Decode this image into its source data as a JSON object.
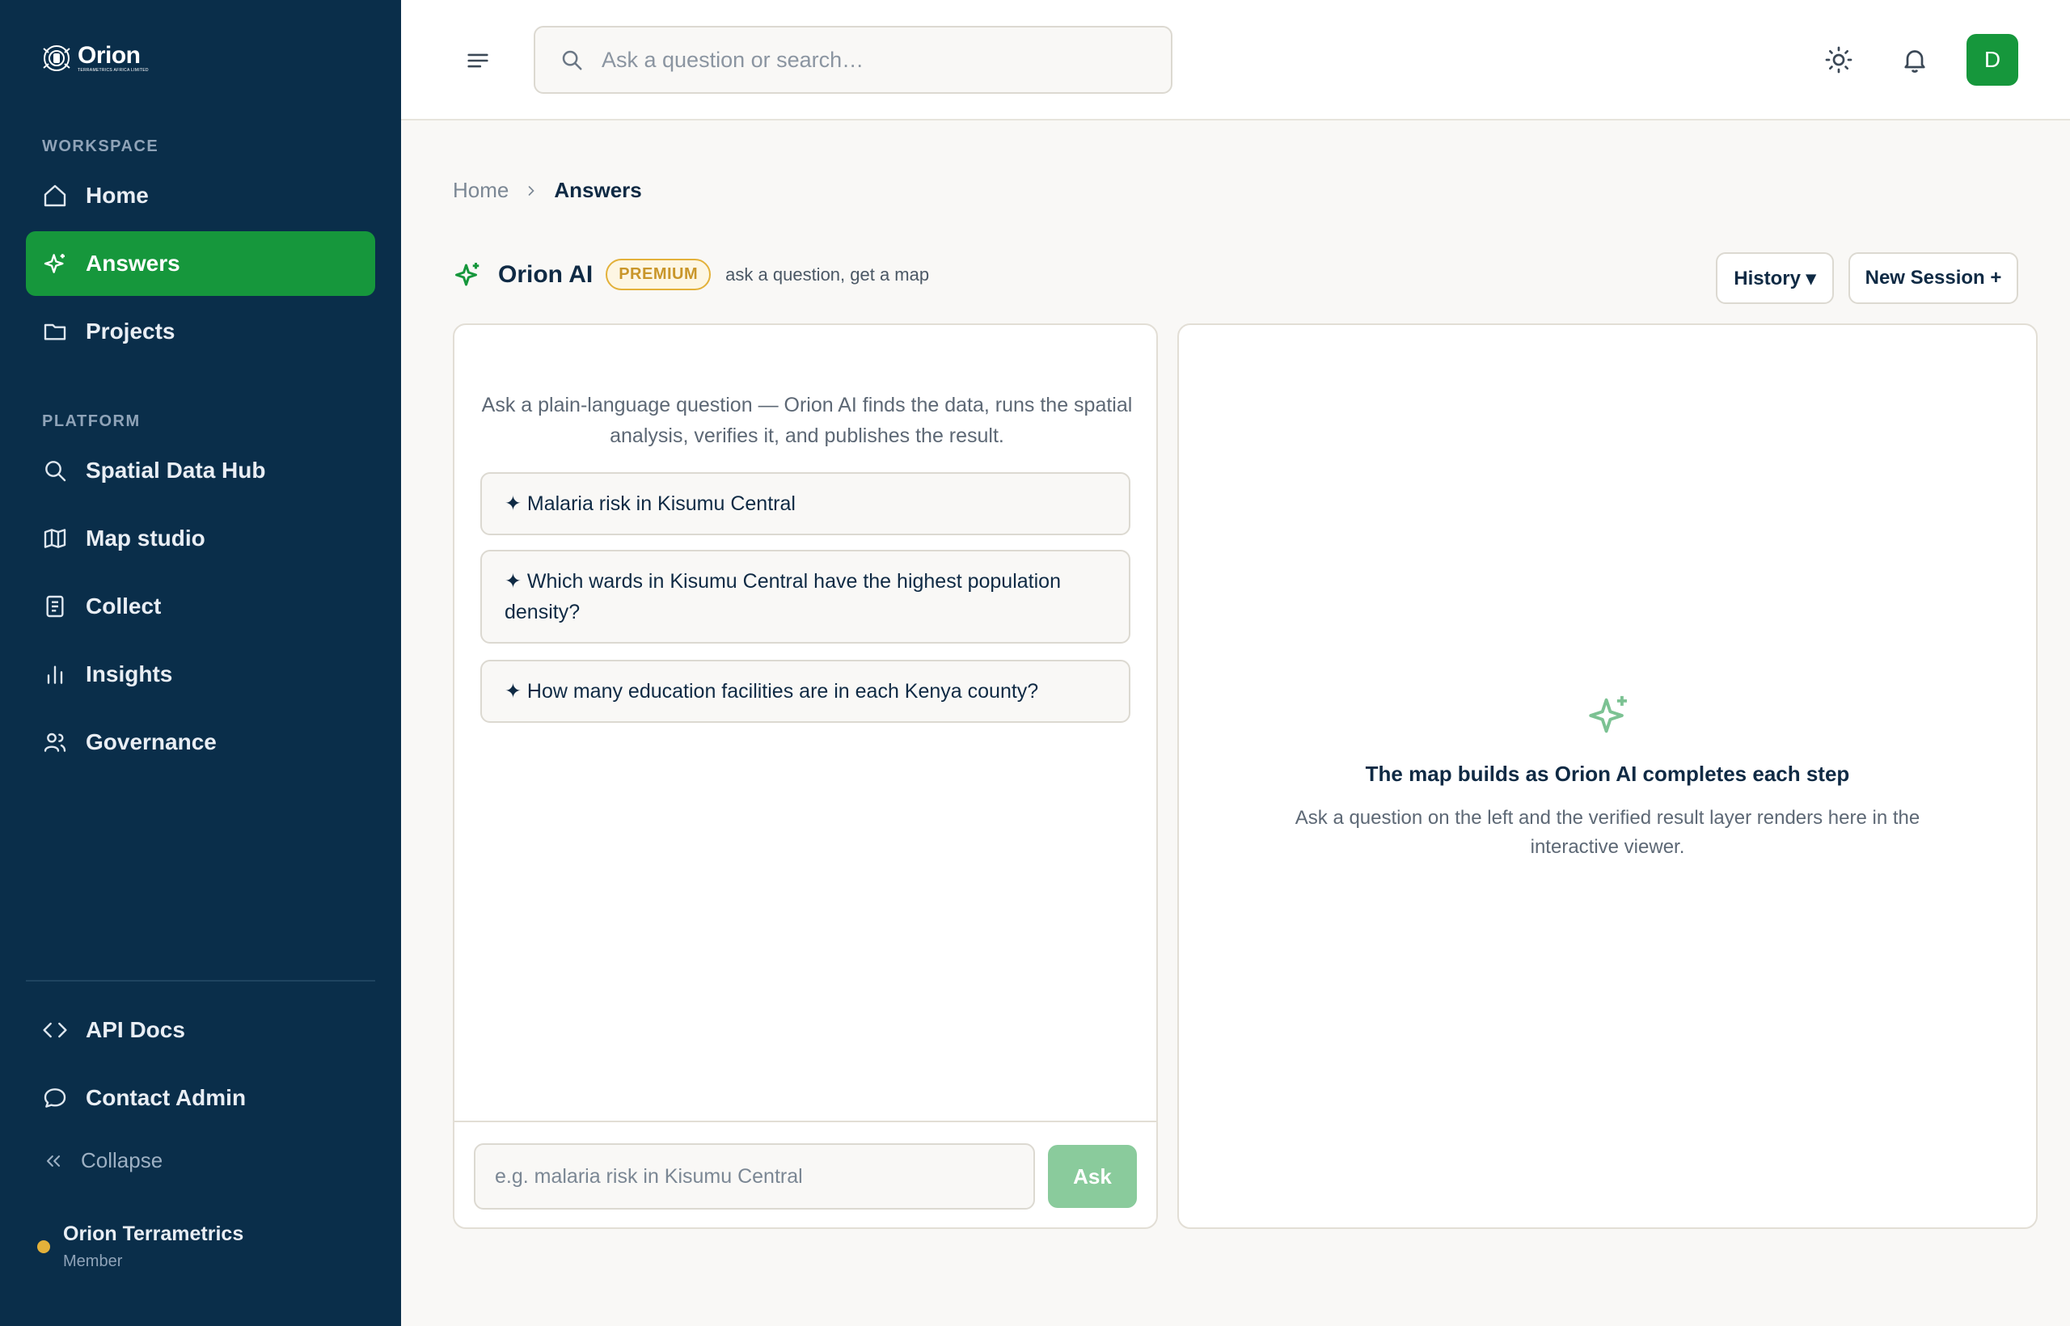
{
  "brand": {
    "name": "Orion",
    "subtitle": "TERRAMETRICS AFRICA LIMITED",
    "accent": "#16973c",
    "sidebar_bg": "#0a2e4a"
  },
  "sidebar": {
    "workspace_label": "WORKSPACE",
    "workspace_items": [
      {
        "label": "Home",
        "icon": "home-icon"
      },
      {
        "label": "Answers",
        "icon": "sparkle-icon",
        "active": true
      },
      {
        "label": "Projects",
        "icon": "folder-icon"
      }
    ],
    "platform_label": "PLATFORM",
    "platform_items": [
      {
        "label": "Spatial Data Hub",
        "icon": "search-icon"
      },
      {
        "label": "Map studio",
        "icon": "map-icon"
      },
      {
        "label": "Collect",
        "icon": "clipboard-icon"
      },
      {
        "label": "Insights",
        "icon": "bar-chart-icon"
      },
      {
        "label": "Governance",
        "icon": "users-icon"
      }
    ],
    "bottom_items": [
      {
        "label": "API Docs",
        "icon": "code-icon"
      },
      {
        "label": "Contact Admin",
        "icon": "chat-icon"
      }
    ],
    "collapse_label": "Collapse",
    "user": {
      "name": "Orion Terrametrics",
      "role": "Member",
      "status_color": "#e3b13a"
    }
  },
  "topbar": {
    "search_placeholder": "Ask a question or search…",
    "avatar_initial": "D"
  },
  "breadcrumb": {
    "home": "Home",
    "current": "Answers"
  },
  "header": {
    "title": "Orion AI",
    "badge": "PREMIUM",
    "tagline": "ask a question, get a map",
    "history_button": "History ▾",
    "new_session_button": "New Session +"
  },
  "chat": {
    "intro": "Ask a plain-language question — Orion AI finds the data, runs the spatial analysis, verifies it, and publishes the result.",
    "suggestions": [
      "✦ Malaria risk in Kisumu Central",
      "✦ Which wards in Kisumu Central have the highest population density?",
      "✦ How many education facilities are in each Kenya county?"
    ],
    "input_placeholder": "e.g. malaria risk in Kisumu Central",
    "ask_button": "Ask"
  },
  "map_panel": {
    "empty_title": "The map builds as Orion AI completes each step",
    "empty_description": "Ask a question on the left and the verified result layer renders here in the interactive viewer."
  }
}
